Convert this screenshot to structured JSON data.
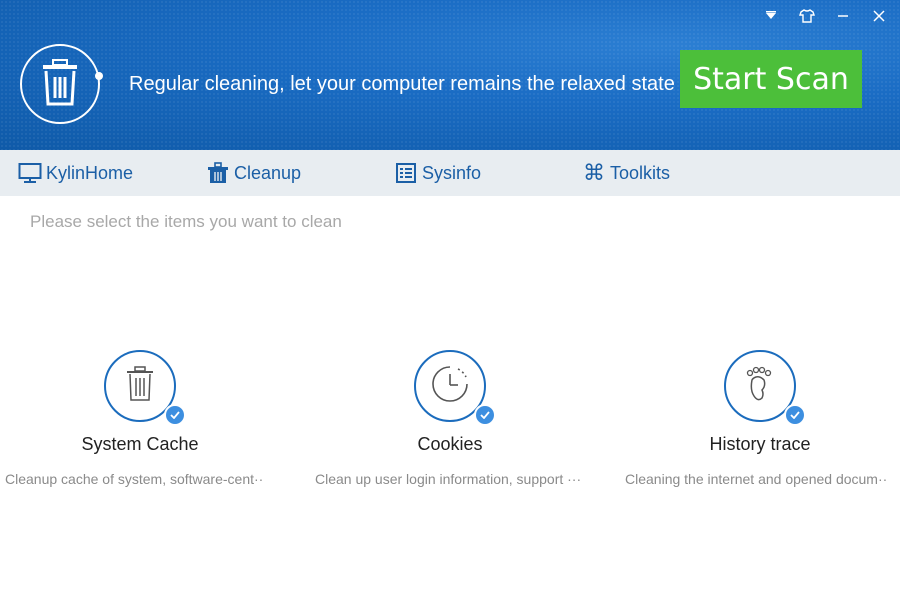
{
  "header": {
    "tagline": "Regular cleaning, let your computer remains the relaxed state",
    "start_scan_label": "Start Scan",
    "window_controls": [
      "dropdown-icon",
      "skin-icon",
      "minimize-icon",
      "close-icon"
    ]
  },
  "nav": {
    "items": [
      {
        "label": "KylinHome",
        "icon": "monitor-icon"
      },
      {
        "label": "Cleanup",
        "icon": "trash-icon"
      },
      {
        "label": "Sysinfo",
        "icon": "list-icon"
      },
      {
        "label": "Toolkits",
        "icon": "command-icon"
      }
    ]
  },
  "main": {
    "hint": "Please select the items you want to clean",
    "items": [
      {
        "title": "System Cache",
        "desc": "Cleanup  cache of system, software-cent··",
        "icon": "trash-icon",
        "checked": true
      },
      {
        "title": "Cookies",
        "desc": "Clean up user login information, support ···",
        "icon": "clock-icon",
        "checked": true
      },
      {
        "title": "History trace",
        "desc": "Cleaning the internet and opened docum··",
        "icon": "footprint-icon",
        "checked": true
      }
    ]
  },
  "colors": {
    "header_blue": "#1a6cc4",
    "start_green": "#4cbf3a",
    "nav_text": "#1b5fa6",
    "check_blue": "#3d8fe0"
  }
}
